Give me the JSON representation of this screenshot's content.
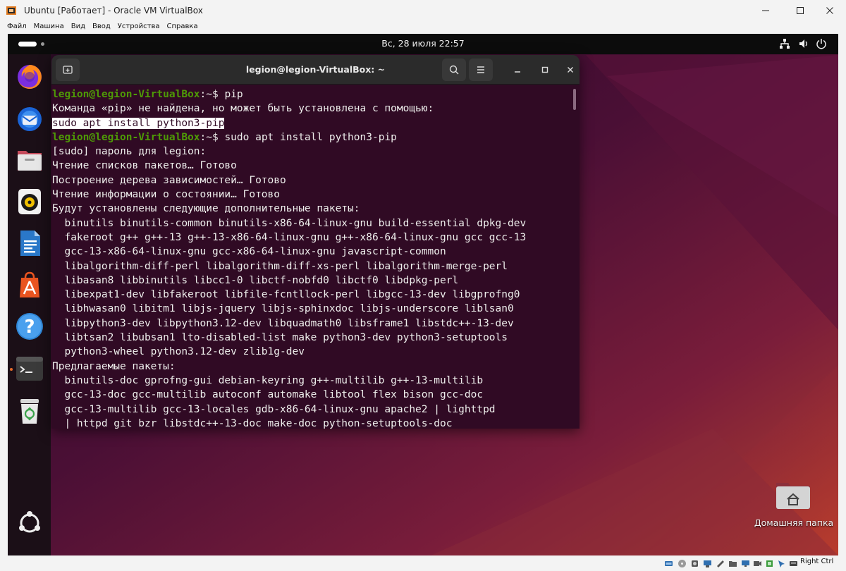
{
  "host_window": {
    "title": "Ubuntu [Работает] - Oracle VM VirtualBox",
    "controls": {
      "minimize": "—",
      "maximize": "☐",
      "close": "✕"
    }
  },
  "host_menu": [
    "Файл",
    "Машина",
    "Вид",
    "Ввод",
    "Устройства",
    "Справка"
  ],
  "ubuntu_topbar": {
    "clock": "Вс, 28 июля  22:57",
    "tray_icons": [
      "network-icon",
      "volume-icon",
      "power-icon"
    ]
  },
  "dock": {
    "apps": [
      {
        "name": "firefox",
        "icon": "firefox-icon"
      },
      {
        "name": "thunderbird",
        "icon": "thunderbird-icon"
      },
      {
        "name": "files",
        "icon": "files-icon"
      },
      {
        "name": "rhythmbox",
        "icon": "rhythmbox-icon"
      },
      {
        "name": "libreoffice-writer",
        "icon": "writer-icon"
      },
      {
        "name": "app-center",
        "icon": "app-center-icon"
      },
      {
        "name": "help",
        "icon": "help-icon"
      },
      {
        "name": "terminal",
        "icon": "terminal-icon",
        "running": true
      },
      {
        "name": "trash",
        "icon": "trash-icon"
      },
      {
        "name": "show-apps",
        "icon": "ubuntu-apps-icon"
      }
    ]
  },
  "terminal": {
    "title": "legion@legion-VirtualBox: ~",
    "new_tab_icon": "new-tab-icon",
    "search_icon": "search-icon",
    "menu_icon": "hamburger-menu-icon",
    "controls": {
      "minimize": "—",
      "maximize": "□",
      "close": "✕"
    },
    "prompt": "legion@legion-VirtualBox",
    "path": ":~$",
    "lines": [
      {
        "type": "prompt",
        "cmd": " pip"
      },
      {
        "type": "text",
        "text": "Команда «pip» не найдена, но может быть установлена с помощью:"
      },
      {
        "type": "highlight",
        "text": "sudo apt install python3-pip"
      },
      {
        "type": "prompt",
        "cmd": " sudo apt install python3-pip"
      },
      {
        "type": "text",
        "text": "[sudo] пароль для legion:"
      },
      {
        "type": "text",
        "text": "Чтение списков пакетов… Готово"
      },
      {
        "type": "text",
        "text": "Построение дерева зависимостей… Готово"
      },
      {
        "type": "text",
        "text": "Чтение информации о состоянии… Готово"
      },
      {
        "type": "text",
        "text": "Будут установлены следующие дополнительные пакеты:"
      },
      {
        "type": "text",
        "text": "  binutils binutils-common binutils-x86-64-linux-gnu build-essential dpkg-dev"
      },
      {
        "type": "text",
        "text": "  fakeroot g++ g++-13 g++-13-x86-64-linux-gnu g++-x86-64-linux-gnu gcc gcc-13"
      },
      {
        "type": "text",
        "text": "  gcc-13-x86-64-linux-gnu gcc-x86-64-linux-gnu javascript-common"
      },
      {
        "type": "text",
        "text": "  libalgorithm-diff-perl libalgorithm-diff-xs-perl libalgorithm-merge-perl"
      },
      {
        "type": "text",
        "text": "  libasan8 libbinutils libcc1-0 libctf-nobfd0 libctf0 libdpkg-perl"
      },
      {
        "type": "text",
        "text": "  libexpat1-dev libfakeroot libfile-fcntllock-perl libgcc-13-dev libgprofng0"
      },
      {
        "type": "text",
        "text": "  libhwasan0 libitm1 libjs-jquery libjs-sphinxdoc libjs-underscore liblsan0"
      },
      {
        "type": "text",
        "text": "  libpython3-dev libpython3.12-dev libquadmath0 libsframe1 libstdc++-13-dev"
      },
      {
        "type": "text",
        "text": "  libtsan2 libubsan1 lto-disabled-list make python3-dev python3-setuptools"
      },
      {
        "type": "text",
        "text": "  python3-wheel python3.12-dev zlib1g-dev"
      },
      {
        "type": "text",
        "text": "Предлагаемые пакеты:"
      },
      {
        "type": "text",
        "text": "  binutils-doc gprofng-gui debian-keyring g++-multilib g++-13-multilib"
      },
      {
        "type": "text",
        "text": "  gcc-13-doc gcc-multilib autoconf automake libtool flex bison gcc-doc"
      },
      {
        "type": "text",
        "text": "  gcc-13-multilib gcc-13-locales gdb-x86-64-linux-gnu apache2 | lighttpd"
      },
      {
        "type": "text",
        "text": "  | httpd git bzr libstdc++-13-doc make-doc python-setuptools-doc"
      }
    ]
  },
  "desktop": {
    "home_folder_label": "Домашняя папка",
    "home_folder_icon": "home-folder-icon"
  },
  "host_status": {
    "host_key": "Right Ctrl",
    "icons": [
      "hdd-icon",
      "optical-icon",
      "audio-icon",
      "network-icon",
      "usb-icon",
      "shared-folder-icon",
      "display-icon",
      "video-capture-icon",
      "cpu-icon",
      "mouse-integration-icon",
      "keyboard-icon"
    ]
  },
  "colors": {
    "terminal_bg": "#300a24",
    "prompt_green": "#4e9a06",
    "ubuntu_orange": "#e95420",
    "desktop_dark": "#3c0e2e"
  }
}
